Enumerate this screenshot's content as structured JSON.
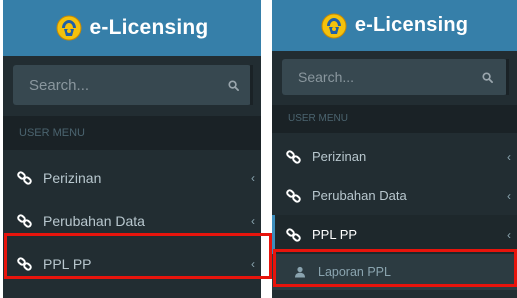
{
  "left_panel": {
    "brand": "e-Licensing",
    "search": {
      "placeholder": "Search..."
    },
    "menu_header": "USER MENU",
    "items": [
      {
        "label": "Perizinan"
      },
      {
        "label": "Perubahan Data"
      },
      {
        "label": "PPL PP"
      }
    ]
  },
  "right_panel": {
    "brand": "e-Licensing",
    "search": {
      "placeholder": "Search..."
    },
    "menu_header": "USER MENU",
    "items": [
      {
        "label": "Perizinan"
      },
      {
        "label": "Perubahan Data"
      },
      {
        "label": "PPL PP"
      }
    ],
    "sub_items": [
      {
        "label": "Laporan PPL"
      }
    ]
  },
  "colors": {
    "sidebar_bg": "#222d32",
    "brand_bg": "#367fa9",
    "active_accent": "#3c8dbc",
    "highlight": "#e8140c"
  },
  "icons": {
    "logo": "kemenkeu-logo",
    "search": "search-icon",
    "menu_item": "link-icon",
    "sub_item": "user-icon",
    "chevron": "chevron-left-icon"
  }
}
